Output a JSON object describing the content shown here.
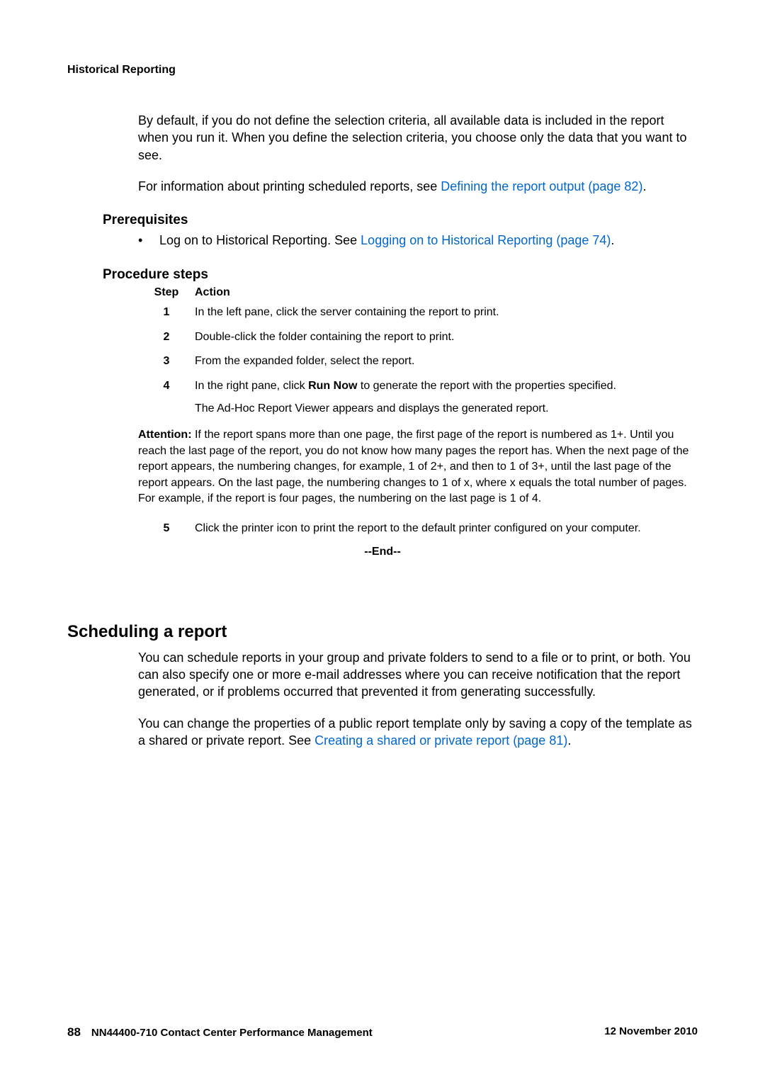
{
  "header": {
    "title": "Historical Reporting"
  },
  "intro": {
    "para1": "By default, if you do not define the selection criteria, all available data is included in the report when you run it. When you define the selection criteria, you choose only the data that you want to see.",
    "para2_pre": "For information about printing scheduled reports, see ",
    "para2_link": "Defining the report output (page 82)",
    "para2_post": "."
  },
  "prereq": {
    "heading": "Prerequisites",
    "bullet_pre": "Log on to Historical Reporting. See ",
    "bullet_link": "Logging on to Historical Reporting (page 74)",
    "bullet_post": "."
  },
  "procedure": {
    "heading": "Procedure steps",
    "col_step": "Step",
    "col_action": "Action",
    "steps": {
      "s1_num": "1",
      "s1_action": "In the left pane, click the server containing the report to print.",
      "s2_num": "2",
      "s2_action": "Double-click the folder containing the report to print.",
      "s3_num": "3",
      "s3_action": "From the expanded folder, select the report.",
      "s4_num": "4",
      "s4_action_pre": "In the right pane, click ",
      "s4_action_bold": "Run Now",
      "s4_action_post": " to generate the report with the properties specified.",
      "s4_sub": "The Ad-Hoc Report Viewer appears and displays the generated report.",
      "s5_num": "5",
      "s5_action": "Click the printer icon to print the report to the default printer configured on your computer."
    },
    "attention_label": "Attention:",
    "attention_body": "If the report spans more than one page, the first page of the report is numbered as 1+. Until you reach the last page of the report, you do not know how many pages the report has. When the next page of the report appears, the numbering changes, for example, 1 of 2+, and then to 1 of 3+, until the last page of the report appears. On the last page, the numbering changes to 1 of x, where x equals the total number of pages. For example, if the report is four pages, the numbering on the last page is 1 of 4.",
    "end": "--End--"
  },
  "scheduling": {
    "heading": "Scheduling a report",
    "para1": "You can schedule reports in your group and private folders to send to a file or to print, or both. You can also specify one or more e-mail addresses where you can receive notification that the report generated, or if problems occurred that prevented it from generating successfully.",
    "para2_pre": "You can change the properties of a public report template only by saving a copy of the template as a shared or private report. See ",
    "para2_link": "Creating a shared or private report (page 81)",
    "para2_post": "."
  },
  "footer": {
    "page": "88",
    "doc": "NN44400-710 Contact Center Performance Management",
    "date": "12 November 2010"
  }
}
